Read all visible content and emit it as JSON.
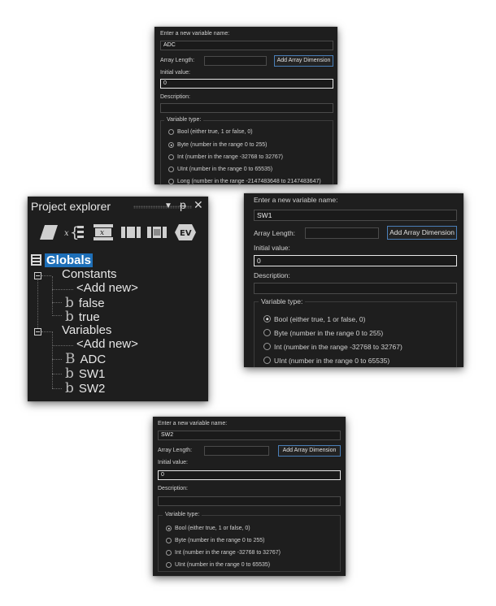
{
  "dialog_adc": {
    "name_label": "Enter a new variable name:",
    "name_value": "ADC",
    "array_length_label": "Array Length:",
    "add_array_dimension": "Add Array Dimension",
    "initial_value_label": "Initial value:",
    "initial_value": "0",
    "description_label": "Description:",
    "variable_type_label": "Variable type:",
    "types": [
      "Bool (either true, 1 or false, 0)",
      "Byte (number in the range 0 to 255)",
      "Int (number in the range -32768 to 32767)",
      "UInt (number in the range 0 to 65535)",
      "Long (number in the range -2147483648 to 2147483647)"
    ],
    "selected_type": "Byte (number in the range 0 to 255)"
  },
  "project_explorer": {
    "title": "Project explorer",
    "icons": [
      "parallelogram-icon",
      "variable-x-icon",
      "x-box-icon",
      "film-strip-icon",
      "grid-strip-icon",
      "ev-badge-icon"
    ],
    "ev_label": "EV",
    "tree": {
      "globals": "Globals",
      "constants": "Constants",
      "add_new_constant": "<Add new>",
      "false": "false",
      "true": "true",
      "variables": "Variables",
      "add_new_variable": "<Add new>",
      "adc": "ADC",
      "sw1": "SW1",
      "sw2": "SW2"
    }
  },
  "dialog_sw1": {
    "name_label": "Enter a new variable name:",
    "name_value": "SW1",
    "array_length_label": "Array Length:",
    "add_array_dimension": "Add Array Dimension",
    "initial_value_label": "Initial value:",
    "initial_value": "0",
    "description_label": "Description:",
    "variable_type_label": "Variable type:",
    "types": [
      "Bool (either true, 1 or false, 0)",
      "Byte (number in the range 0 to 255)",
      "Int (number in the range -32768 to 32767)",
      "UInt (number in the range 0 to 65535)"
    ],
    "selected_type": "Bool (either true, 1 or false, 0)"
  },
  "dialog_sw2": {
    "name_label": "Enter a new variable name:",
    "name_value": "SW2",
    "array_length_label": "Array Length:",
    "add_array_dimension": "Add Array Dimension",
    "initial_value_label": "Initial value:",
    "initial_value": "0",
    "description_label": "Description:",
    "variable_type_label": "Variable type:",
    "types": [
      "Bool (either true, 1 or false, 0)",
      "Byte (number in the range 0 to 255)",
      "Int (number in the range -32768 to 32767)",
      "UInt (number in the range 0 to 65535)"
    ],
    "selected_type": "Bool (either true, 1 or false, 0)"
  },
  "colors": {
    "panel_background": "#1e1e1e",
    "button_border": "#4a7fb8",
    "selection": "#1e6fb8",
    "text": "#d4d4d4"
  }
}
